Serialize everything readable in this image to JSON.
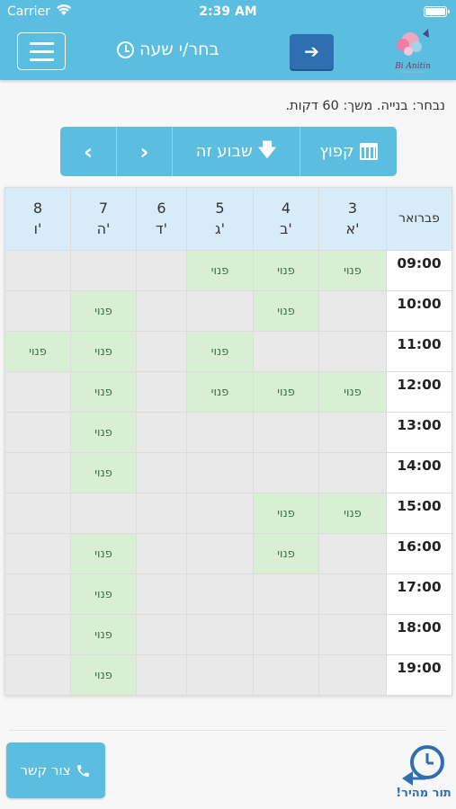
{
  "status": {
    "carrier": "Carrier",
    "time": "2:39 AM"
  },
  "navbar": {
    "title": "בחר/י שעה",
    "next_symbol": "➔",
    "logo_text": "Bi Anitin"
  },
  "chosen": "נבחר: בנייה. משך: 60 דקות.",
  "week_nav": {
    "jump": "קפוץ",
    "this_week": "שבוע זה",
    "next": "›",
    "prev": "‹"
  },
  "calendar": {
    "month": "פברואר",
    "days": [
      {
        "num": "3",
        "name": "א'"
      },
      {
        "num": "4",
        "name": "ב'"
      },
      {
        "num": "5",
        "name": "ג'"
      },
      {
        "num": "6",
        "name": "ד'"
      },
      {
        "num": "7",
        "name": "ה'"
      },
      {
        "num": "8",
        "name": "ו'"
      }
    ],
    "free_label": "פנוי",
    "rows": [
      {
        "hour": "09:00",
        "slots": [
          true,
          true,
          true,
          false,
          false,
          false
        ]
      },
      {
        "hour": "10:00",
        "slots": [
          false,
          true,
          false,
          false,
          true,
          false
        ]
      },
      {
        "hour": "11:00",
        "slots": [
          false,
          false,
          true,
          false,
          true,
          true
        ]
      },
      {
        "hour": "12:00",
        "slots": [
          true,
          true,
          true,
          false,
          true,
          false
        ]
      },
      {
        "hour": "13:00",
        "slots": [
          false,
          false,
          false,
          false,
          true,
          false
        ]
      },
      {
        "hour": "14:00",
        "slots": [
          false,
          false,
          false,
          false,
          true,
          false
        ]
      },
      {
        "hour": "15:00",
        "slots": [
          true,
          true,
          false,
          false,
          false,
          false
        ]
      },
      {
        "hour": "16:00",
        "slots": [
          false,
          true,
          false,
          false,
          true,
          false
        ]
      },
      {
        "hour": "17:00",
        "slots": [
          false,
          false,
          false,
          false,
          true,
          false
        ]
      },
      {
        "hour": "18:00",
        "slots": [
          false,
          false,
          false,
          false,
          true,
          false
        ]
      },
      {
        "hour": "19:00",
        "slots": [
          false,
          false,
          false,
          false,
          true,
          false
        ]
      }
    ]
  },
  "footer": {
    "contact": "צור קשר",
    "quick": "תור מהיר!"
  },
  "colors": {
    "primary": "#5bbde0",
    "dark_blue": "#2e6fb1",
    "free": "#d9efd3",
    "header": "#d7ecf8"
  }
}
